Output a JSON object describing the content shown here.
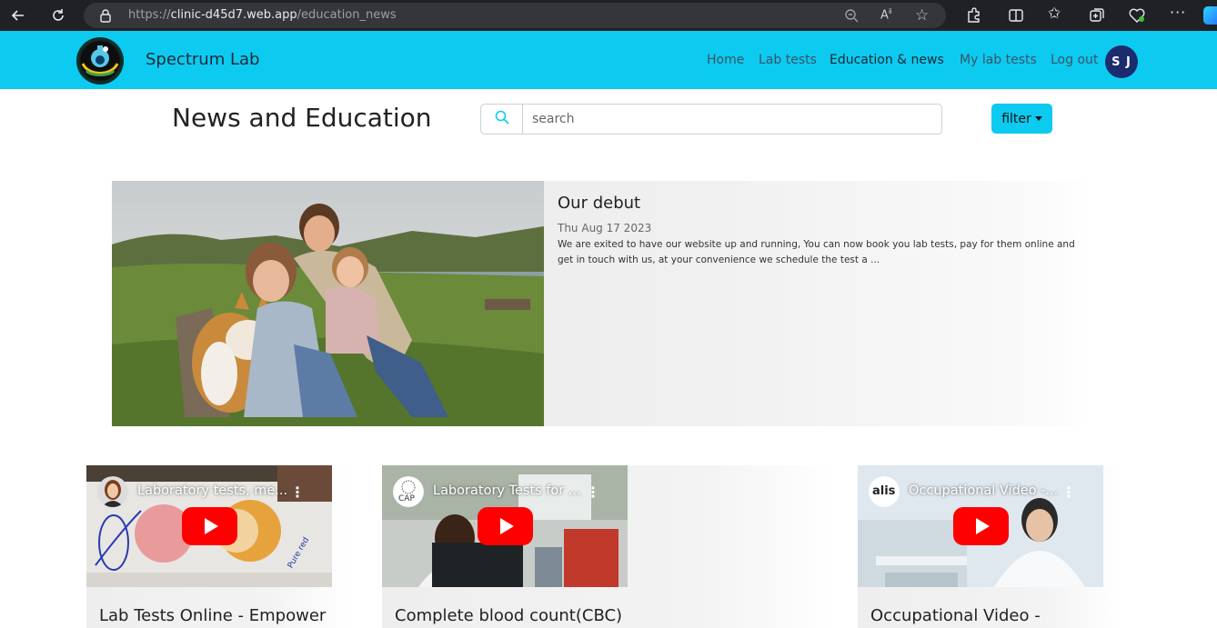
{
  "browser": {
    "url_prefix": "https://",
    "url_host": "clinic-d45d7.web.app",
    "url_path": "/education_news"
  },
  "navbar": {
    "brand": "Spectrum Lab",
    "items": [
      {
        "label": "Home"
      },
      {
        "label": "Lab tests"
      },
      {
        "label": "Education & news"
      },
      {
        "label": "My lab tests"
      },
      {
        "label": "Log out"
      }
    ],
    "avatar_initials": "S J",
    "bg_color": "#0dcaf0"
  },
  "header": {
    "title": "News and Education",
    "search_placeholder": "search",
    "filter_label": "filter"
  },
  "featured": {
    "title": "Our debut",
    "date": "Thu Aug 17 2023",
    "excerpt": "We are exited to have our website up and running, You can now book you lab tests, pay for them online and get in touch with us, at your convenience we schedule the test a ..."
  },
  "videos": [
    {
      "video_title": "Laboratory tests, me...",
      "card_title": "Lab Tests Online - Empower"
    },
    {
      "video_title": "Laboratory Tests for ...",
      "channel_badge": "CAP",
      "card_title": "Complete blood count(CBC)"
    },
    {
      "video_title": "Occupational Video -...",
      "channel_badge": "alis",
      "card_title": "Occupational Video -"
    }
  ]
}
